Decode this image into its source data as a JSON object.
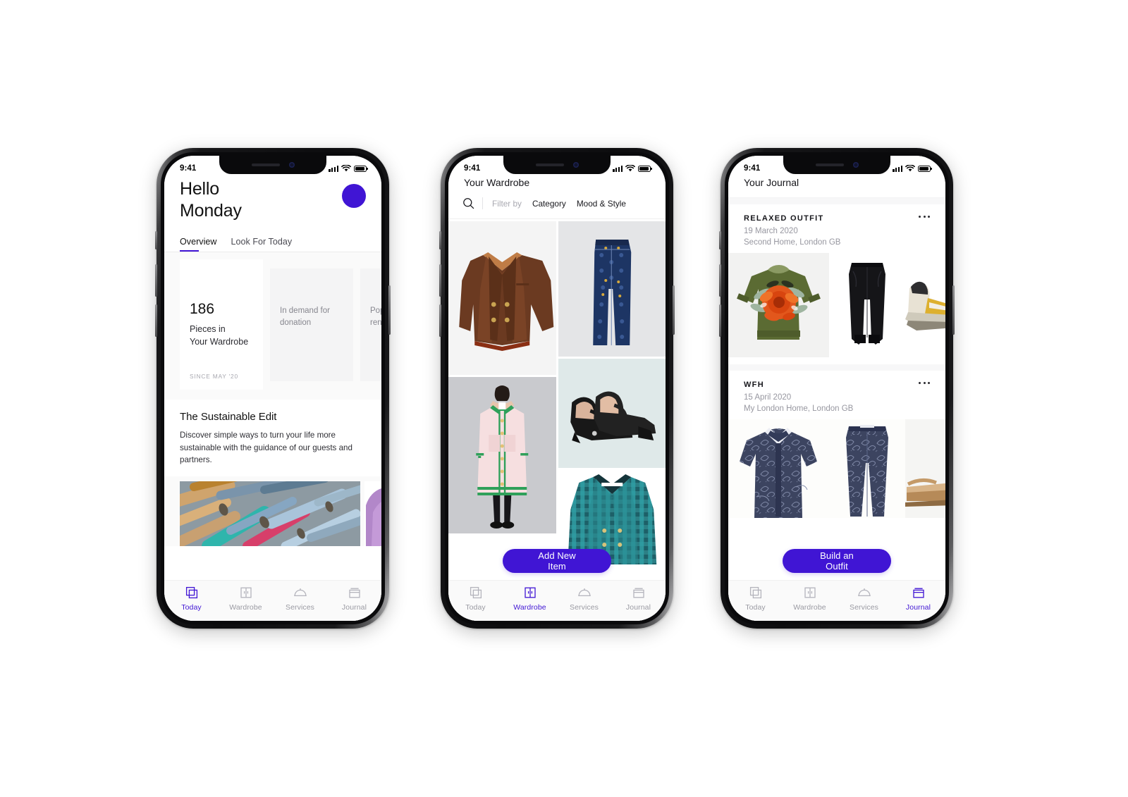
{
  "theme": {
    "accent": "#4015d4",
    "bg": "#ffffff",
    "muted": "#9a9aa2",
    "panel": "#fafafa"
  },
  "status_bar": {
    "time": "9:41",
    "signal_icon": "cellular-bars-icon",
    "wifi_icon": "wifi-icon",
    "battery_icon": "battery-icon"
  },
  "tab_bar": {
    "items": [
      {
        "label": "Today",
        "icon": "today-squares-icon"
      },
      {
        "label": "Wardrobe",
        "icon": "wardrobe-closet-icon"
      },
      {
        "label": "Services",
        "icon": "services-bell-icon"
      },
      {
        "label": "Journal",
        "icon": "journal-box-icon"
      }
    ]
  },
  "phone1": {
    "greeting_line1": "Hello",
    "greeting_line2": "Monday",
    "avatar": "user-avatar",
    "tabs": [
      {
        "label": "Overview",
        "selected": true
      },
      {
        "label": "Look For Today",
        "selected": false
      }
    ],
    "stats": [
      {
        "number": "186",
        "desc_line1": "Pieces in",
        "desc_line2": "Your Wardrobe",
        "footnote": "SINCE MAY '20"
      },
      {
        "desc_line1": "In demand for",
        "desc_line2": "donation"
      },
      {
        "desc_line1": "Popular",
        "desc_line2": "rental m"
      }
    ],
    "edit": {
      "title": "The Sustainable Edit",
      "body": "Discover simple ways to turn your life more sustainable with the guidance of our guests and partners."
    },
    "strip": [
      {
        "name": "yarn-spools-photo"
      },
      {
        "name": "purple-knit-photo"
      }
    ],
    "active_tab": "Today"
  },
  "phone2": {
    "title": "Your Wardrobe",
    "search_icon": "search-icon",
    "filter_label": "Filter by",
    "filter_options": [
      "Category",
      "Mood & Style"
    ],
    "grid": [
      {
        "name": "brown-blazer-item",
        "bg": "#f4f4f4"
      },
      {
        "name": "pink-green-trim-coat-item",
        "bg": "#c9cace"
      },
      {
        "name": "blue-printed-trousers-item",
        "bg": "#e4e5e7"
      },
      {
        "name": "black-mary-jane-heels-item",
        "bg": "#dfe9e9"
      },
      {
        "name": "green-check-blazer-item",
        "bg": "#ffffff"
      }
    ],
    "cta": "Add New Item",
    "active_tab": "Wardrobe"
  },
  "phone3": {
    "title": "Your Journal",
    "entries": [
      {
        "name": "RELAXED OUTFIT",
        "date": "19 March 2020",
        "location": "Second Home, London GB",
        "menu_icon": "more-options-icon",
        "items": [
          {
            "name": "green-floral-sweater-item",
            "bg": "#f2f2f1"
          },
          {
            "name": "black-tapered-trousers-item",
            "bg": "#ffffff"
          },
          {
            "name": "beige-sneaker-item",
            "bg": "#ffffff"
          }
        ]
      },
      {
        "name": "WFH",
        "date": "15 April 2020",
        "location": "My London Home, London GB",
        "menu_icon": "more-options-icon",
        "items": [
          {
            "name": "navy-printed-shirt-item",
            "bg": "#fdfdfb"
          },
          {
            "name": "navy-printed-trousers-item",
            "bg": "#fdfdfb"
          },
          {
            "name": "tan-sandal-item",
            "bg": "#f5f5f3"
          }
        ]
      }
    ],
    "cta": "Build an Outfit",
    "active_tab": "Journal"
  }
}
